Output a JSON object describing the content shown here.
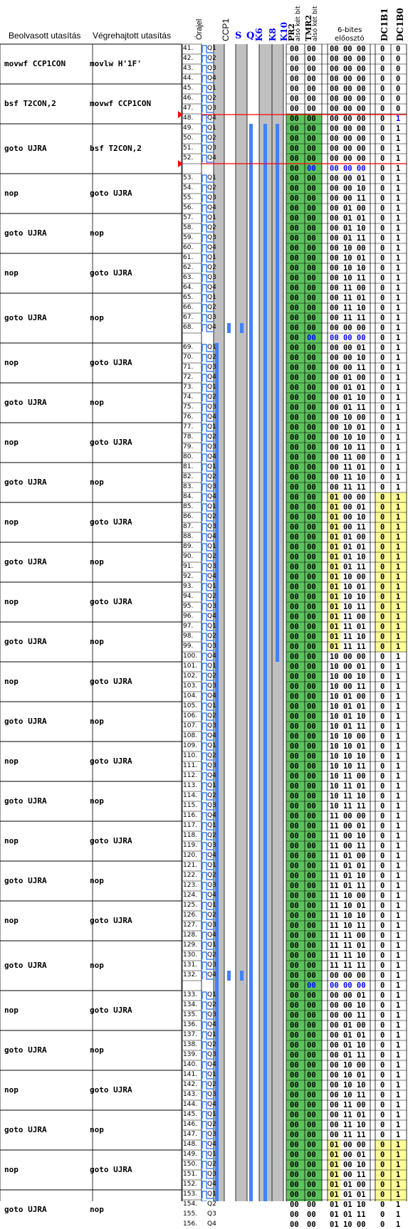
{
  "headers": {
    "read_instruction": "Beolvasott utasítás",
    "executed_instruction": "Végrehajtott utasítás",
    "clock": "Órajel",
    "ccp1": "CCP1",
    "s": "S",
    "q": "Q",
    "k6": "K6",
    "k8": "K8",
    "k10": "K10",
    "pr2_name": "PR2",
    "pr2_sub": "alsó két bit",
    "tmr2_name": "TMR2",
    "tmr2_sub": "alsó két bit",
    "prescaler_line1": "6-bites",
    "prescaler_line2": "előosztó",
    "dc1b1": "DC1B1",
    "dc1b0": "DC1B0"
  },
  "colors": {
    "grid": "#000000",
    "blue_wave": "#3f82ff",
    "blue_text": "#0000ff",
    "gray_column": "#c0c0c0",
    "green_fill": "#5dc35d",
    "yellow_fill": "#ffff99",
    "red_marker": "#ff0000"
  },
  "blocks": [
    {
      "read": "movwf  CCP1CON",
      "exec": "movlw  H'1F'"
    },
    {
      "read": "bsf    T2CON,2",
      "exec": "movwf  CCP1CON"
    },
    {
      "read": "goto   UJRA",
      "exec": "bsf    T2CON,2"
    },
    {
      "read": "nop",
      "exec": "goto   UJRA"
    },
    {
      "read": "goto   UJRA",
      "exec": "nop"
    },
    {
      "read": "nop",
      "exec": "goto   UJRA"
    },
    {
      "read": "goto   UJRA",
      "exec": "nop"
    },
    {
      "read": "nop",
      "exec": "goto   UJRA"
    },
    {
      "read": "goto   UJRA",
      "exec": "nop"
    },
    {
      "read": "nop",
      "exec": "goto   UJRA"
    },
    {
      "read": "goto   UJRA",
      "exec": "nop"
    },
    {
      "read": "nop",
      "exec": "goto   UJRA"
    },
    {
      "read": "goto   UJRA",
      "exec": "nop"
    },
    {
      "read": "nop",
      "exec": "goto   UJRA"
    },
    {
      "read": "goto   UJRA",
      "exec": "nop"
    },
    {
      "read": "nop",
      "exec": "goto   UJRA"
    },
    {
      "read": "goto   UJRA",
      "exec": "nop"
    },
    {
      "read": "nop",
      "exec": "goto   UJRA"
    },
    {
      "read": "goto   UJRA",
      "exec": "nop"
    },
    {
      "read": "nop",
      "exec": "goto   UJRA"
    },
    {
      "read": "goto   UJRA",
      "exec": "nop"
    },
    {
      "read": "nop",
      "exec": "goto   UJRA"
    },
    {
      "read": "goto   UJRA",
      "exec": "nop"
    },
    {
      "read": "nop",
      "exec": "goto   UJRA"
    },
    {
      "read": "goto   UJRA",
      "exec": "nop"
    },
    {
      "read": "nop",
      "exec": "goto   UJRA"
    },
    {
      "read": "goto   UJRA",
      "exec": "nop"
    },
    {
      "read": "nop",
      "exec": "goto   UJRA"
    },
    {
      "read": "goto   UJRA",
      "exec": "nop"
    }
  ],
  "rows": [
    {
      "n": "41.",
      "q": "Q1",
      "pr2": "00",
      "tmr2": "00",
      "pre": "00 00 00",
      "b1": "0",
      "b0": "0"
    },
    {
      "n": "42.",
      "q": "Q2",
      "pr2": "00",
      "tmr2": "00",
      "pre": "00 00 00",
      "b1": "0",
      "b0": "0"
    },
    {
      "n": "43.",
      "q": "Q3",
      "pr2": "00",
      "tmr2": "00",
      "pre": "00 00 00",
      "b1": "0",
      "b0": "0"
    },
    {
      "n": "44.",
      "q": "Q4",
      "pr2": "00",
      "tmr2": "00",
      "pre": "00 00 00",
      "b1": "0",
      "b0": "0"
    },
    {
      "n": "45.",
      "q": "Q1",
      "pr2": "00",
      "tmr2": "00",
      "pre": "00 00 00",
      "b1": "0",
      "b0": "0"
    },
    {
      "n": "46.",
      "q": "Q2",
      "pr2": "00",
      "tmr2": "00",
      "pre": "00 00 00",
      "b1": "0",
      "b0": "0"
    },
    {
      "n": "47.",
      "q": "Q3",
      "pr2": "00",
      "tmr2": "00",
      "pre": "00 00 00",
      "b1": "0",
      "b0": "0"
    },
    {
      "n": "48.",
      "q": "Q4",
      "pr2": "00",
      "tmr2": "00",
      "pre": "00 00 00",
      "b1": "0",
      "b0": "1"
    },
    {
      "n": "49.",
      "q": "Q1",
      "pr2": "00",
      "tmr2": "00",
      "pre": "00 00 00",
      "b1": "0",
      "b0": "1"
    },
    {
      "n": "50.",
      "q": "Q2",
      "pr2": "00",
      "tmr2": "00",
      "pre": "00 00 00",
      "b1": "0",
      "b0": "1"
    },
    {
      "n": "51.",
      "q": "Q3",
      "pr2": "00",
      "tmr2": "00",
      "pre": "00 00 00",
      "b1": "0",
      "b0": "1"
    },
    {
      "n": "52.",
      "q": "Q4",
      "pr2": "00",
      "tmr2": "00",
      "pre": "00 00 00",
      "b1": "0",
      "b0": "1"
    },
    {
      "n": "53.",
      "q": "Q1",
      "pr2": "00",
      "tmr2": "00",
      "pre": "00 00 01",
      "b1": "0",
      "b0": "1"
    },
    {
      "n": "54.",
      "q": "Q2",
      "pr2": "00",
      "tmr2": "00",
      "pre": "00 00 10",
      "b1": "0",
      "b0": "1"
    },
    {
      "n": "55.",
      "q": "Q3",
      "pr2": "00",
      "tmr2": "00",
      "pre": "00 00 11",
      "b1": "0",
      "b0": "1"
    },
    {
      "n": "56.",
      "q": "Q4",
      "pr2": "00",
      "tmr2": "00",
      "pre": "00 01 00",
      "b1": "0",
      "b0": "1"
    },
    {
      "n": "57.",
      "q": "Q1",
      "pr2": "00",
      "tmr2": "00",
      "pre": "00 01 01",
      "b1": "0",
      "b0": "1"
    },
    {
      "n": "58.",
      "q": "Q2",
      "pr2": "00",
      "tmr2": "00",
      "pre": "00 01 10",
      "b1": "0",
      "b0": "1"
    },
    {
      "n": "59.",
      "q": "Q3",
      "pr2": "00",
      "tmr2": "00",
      "pre": "00 01 11",
      "b1": "0",
      "b0": "1"
    },
    {
      "n": "60.",
      "q": "Q4",
      "pr2": "00",
      "tmr2": "00",
      "pre": "00 10 00",
      "b1": "0",
      "b0": "1"
    },
    {
      "n": "61.",
      "q": "Q1",
      "pr2": "00",
      "tmr2": "00",
      "pre": "00 10 01",
      "b1": "0",
      "b0": "1"
    },
    {
      "n": "62.",
      "q": "Q2",
      "pr2": "00",
      "tmr2": "00",
      "pre": "00 10 10",
      "b1": "0",
      "b0": "1"
    },
    {
      "n": "63.",
      "q": "Q3",
      "pr2": "00",
      "tmr2": "00",
      "pre": "00 10 11",
      "b1": "0",
      "b0": "1"
    },
    {
      "n": "64.",
      "q": "Q4",
      "pr2": "00",
      "tmr2": "00",
      "pre": "00 11 00",
      "b1": "0",
      "b0": "1"
    },
    {
      "n": "65.",
      "q": "Q1",
      "pr2": "00",
      "tmr2": "00",
      "pre": "00 11 01",
      "b1": "0",
      "b0": "1"
    },
    {
      "n": "66.",
      "q": "Q2",
      "pr2": "00",
      "tmr2": "00",
      "pre": "00 11 10",
      "b1": "0",
      "b0": "1"
    },
    {
      "n": "67.",
      "q": "Q3",
      "pr2": "00",
      "tmr2": "00",
      "pre": "00 11 11",
      "b1": "0",
      "b0": "1"
    },
    {
      "n": "68.",
      "q": "Q4",
      "pr2": "00",
      "tmr2": "00",
      "pre": "00 00 00",
      "b1": "0",
      "b0": "1"
    },
    {
      "n": "69.",
      "q": "Q1",
      "pr2": "00",
      "tmr2": "00",
      "pre": "00 00 01",
      "b1": "0",
      "b0": "1"
    },
    {
      "n": "70.",
      "q": "Q2",
      "pr2": "00",
      "tmr2": "00",
      "pre": "00 00 10",
      "b1": "0",
      "b0": "1"
    },
    {
      "n": "71.",
      "q": "Q3",
      "pr2": "00",
      "tmr2": "00",
      "pre": "00 00 11",
      "b1": "0",
      "b0": "1"
    },
    {
      "n": "72.",
      "q": "Q4",
      "pr2": "00",
      "tmr2": "00",
      "pre": "00 01 00",
      "b1": "0",
      "b0": "1"
    },
    {
      "n": "73.",
      "q": "Q1",
      "pr2": "00",
      "tmr2": "00",
      "pre": "00 01 01",
      "b1": "0",
      "b0": "1"
    },
    {
      "n": "74.",
      "q": "Q2",
      "pr2": "00",
      "tmr2": "00",
      "pre": "00 01 10",
      "b1": "0",
      "b0": "1"
    },
    {
      "n": "75.",
      "q": "Q3",
      "pr2": "00",
      "tmr2": "00",
      "pre": "00 01 11",
      "b1": "0",
      "b0": "1"
    },
    {
      "n": "76.",
      "q": "Q4",
      "pr2": "00",
      "tmr2": "00",
      "pre": "00 10 00",
      "b1": "0",
      "b0": "1"
    },
    {
      "n": "77.",
      "q": "Q1",
      "pr2": "00",
      "tmr2": "00",
      "pre": "00 10 01",
      "b1": "0",
      "b0": "1"
    },
    {
      "n": "78.",
      "q": "Q2",
      "pr2": "00",
      "tmr2": "00",
      "pre": "00 10 10",
      "b1": "0",
      "b0": "1"
    },
    {
      "n": "79.",
      "q": "Q3",
      "pr2": "00",
      "tmr2": "00",
      "pre": "00 10 11",
      "b1": "0",
      "b0": "1"
    },
    {
      "n": "80.",
      "q": "Q4",
      "pr2": "00",
      "tmr2": "00",
      "pre": "00 11 00",
      "b1": "0",
      "b0": "1"
    },
    {
      "n": "81.",
      "q": "Q1",
      "pr2": "00",
      "tmr2": "00",
      "pre": "00 11 01",
      "b1": "0",
      "b0": "1"
    },
    {
      "n": "82.",
      "q": "Q2",
      "pr2": "00",
      "tmr2": "00",
      "pre": "00 11 10",
      "b1": "0",
      "b0": "1"
    },
    {
      "n": "83.",
      "q": "Q3",
      "pr2": "00",
      "tmr2": "00",
      "pre": "00 11 11",
      "b1": "0",
      "b0": "1"
    },
    {
      "n": "84.",
      "q": "Q4",
      "pr2": "00",
      "tmr2": "00",
      "pre": "01 00 00",
      "b1": "0",
      "b0": "1"
    },
    {
      "n": "85.",
      "q": "Q1",
      "pr2": "00",
      "tmr2": "00",
      "pre": "01 00 01",
      "b1": "0",
      "b0": "1"
    },
    {
      "n": "86.",
      "q": "Q2",
      "pr2": "00",
      "tmr2": "00",
      "pre": "01 00 10",
      "b1": "0",
      "b0": "1"
    },
    {
      "n": "87.",
      "q": "Q3",
      "pr2": "00",
      "tmr2": "00",
      "pre": "01 00 11",
      "b1": "0",
      "b0": "1"
    },
    {
      "n": "88.",
      "q": "Q4",
      "pr2": "00",
      "tmr2": "00",
      "pre": "01 01 00",
      "b1": "0",
      "b0": "1"
    },
    {
      "n": "89.",
      "q": "Q1",
      "pr2": "00",
      "tmr2": "00",
      "pre": "01 01 01",
      "b1": "0",
      "b0": "1"
    },
    {
      "n": "90.",
      "q": "Q2",
      "pr2": "00",
      "tmr2": "00",
      "pre": "01 01 10",
      "b1": "0",
      "b0": "1"
    },
    {
      "n": "91.",
      "q": "Q3",
      "pr2": "00",
      "tmr2": "00",
      "pre": "01 01 11",
      "b1": "0",
      "b0": "1"
    },
    {
      "n": "92.",
      "q": "Q4",
      "pr2": "00",
      "tmr2": "00",
      "pre": "01 10 00",
      "b1": "0",
      "b0": "1"
    },
    {
      "n": "93.",
      "q": "Q1",
      "pr2": "00",
      "tmr2": "00",
      "pre": "01 10 01",
      "b1": "0",
      "b0": "1"
    },
    {
      "n": "94.",
      "q": "Q2",
      "pr2": "00",
      "tmr2": "00",
      "pre": "01 10 10",
      "b1": "0",
      "b0": "1"
    },
    {
      "n": "95.",
      "q": "Q3",
      "pr2": "00",
      "tmr2": "00",
      "pre": "01 10 11",
      "b1": "0",
      "b0": "1"
    },
    {
      "n": "96.",
      "q": "Q4",
      "pr2": "00",
      "tmr2": "00",
      "pre": "01 11 00",
      "b1": "0",
      "b0": "1"
    },
    {
      "n": "97.",
      "q": "Q1",
      "pr2": "00",
      "tmr2": "00",
      "pre": "01 11 01",
      "b1": "0",
      "b0": "1"
    },
    {
      "n": "98.",
      "q": "Q2",
      "pr2": "00",
      "tmr2": "00",
      "pre": "01 11 10",
      "b1": "0",
      "b0": "1"
    },
    {
      "n": "99.",
      "q": "Q3",
      "pr2": "00",
      "tmr2": "00",
      "pre": "01 11 11",
      "b1": "0",
      "b0": "1"
    },
    {
      "n": "100.",
      "q": "Q4",
      "pr2": "00",
      "tmr2": "00",
      "pre": "10 00 00",
      "b1": "0",
      "b0": "1"
    },
    {
      "n": "101.",
      "q": "Q1",
      "pr2": "00",
      "tmr2": "00",
      "pre": "10 00 01",
      "b1": "0",
      "b0": "1"
    },
    {
      "n": "102.",
      "q": "Q2",
      "pr2": "00",
      "tmr2": "00",
      "pre": "10 00 10",
      "b1": "0",
      "b0": "1"
    },
    {
      "n": "103.",
      "q": "Q3",
      "pr2": "00",
      "tmr2": "00",
      "pre": "10 00 11",
      "b1": "0",
      "b0": "1"
    },
    {
      "n": "104.",
      "q": "Q4",
      "pr2": "00",
      "tmr2": "00",
      "pre": "10 01 00",
      "b1": "0",
      "b0": "1"
    },
    {
      "n": "105.",
      "q": "Q1",
      "pr2": "00",
      "tmr2": "00",
      "pre": "10 01 01",
      "b1": "0",
      "b0": "1"
    },
    {
      "n": "106.",
      "q": "Q2",
      "pr2": "00",
      "tmr2": "00",
      "pre": "10 01 10",
      "b1": "0",
      "b0": "1"
    },
    {
      "n": "107.",
      "q": "Q3",
      "pr2": "00",
      "tmr2": "00",
      "pre": "10 01 11",
      "b1": "0",
      "b0": "1"
    },
    {
      "n": "108.",
      "q": "Q4",
      "pr2": "00",
      "tmr2": "00",
      "pre": "10 10 00",
      "b1": "0",
      "b0": "1"
    },
    {
      "n": "109.",
      "q": "Q1",
      "pr2": "00",
      "tmr2": "00",
      "pre": "10 10 01",
      "b1": "0",
      "b0": "1"
    },
    {
      "n": "110.",
      "q": "Q2",
      "pr2": "00",
      "tmr2": "00",
      "pre": "10 10 10",
      "b1": "0",
      "b0": "1"
    },
    {
      "n": "111.",
      "q": "Q3",
      "pr2": "00",
      "tmr2": "00",
      "pre": "10 10 11",
      "b1": "0",
      "b0": "1"
    },
    {
      "n": "112.",
      "q": "Q4",
      "pr2": "00",
      "tmr2": "00",
      "pre": "10 11 00",
      "b1": "0",
      "b0": "1"
    },
    {
      "n": "113.",
      "q": "Q1",
      "pr2": "00",
      "tmr2": "00",
      "pre": "10 11 01",
      "b1": "0",
      "b0": "1"
    },
    {
      "n": "114.",
      "q": "Q2",
      "pr2": "00",
      "tmr2": "00",
      "pre": "10 11 10",
      "b1": "0",
      "b0": "1"
    },
    {
      "n": "115.",
      "q": "Q3",
      "pr2": "00",
      "tmr2": "00",
      "pre": "10 11 11",
      "b1": "0",
      "b0": "1"
    },
    {
      "n": "116.",
      "q": "Q4",
      "pr2": "00",
      "tmr2": "00",
      "pre": "11 00 00",
      "b1": "0",
      "b0": "1"
    },
    {
      "n": "117.",
      "q": "Q1",
      "pr2": "00",
      "tmr2": "00",
      "pre": "11 00 01",
      "b1": "0",
      "b0": "1"
    },
    {
      "n": "118.",
      "q": "Q2",
      "pr2": "00",
      "tmr2": "00",
      "pre": "11 00 10",
      "b1": "0",
      "b0": "1"
    },
    {
      "n": "119.",
      "q": "Q3",
      "pr2": "00",
      "tmr2": "00",
      "pre": "11 00 11",
      "b1": "0",
      "b0": "1"
    },
    {
      "n": "120.",
      "q": "Q4",
      "pr2": "00",
      "tmr2": "00",
      "pre": "11 01 00",
      "b1": "0",
      "b0": "1"
    },
    {
      "n": "121.",
      "q": "Q1",
      "pr2": "00",
      "tmr2": "00",
      "pre": "11 01 01",
      "b1": "0",
      "b0": "1"
    },
    {
      "n": "122.",
      "q": "Q2",
      "pr2": "00",
      "tmr2": "00",
      "pre": "11 01 10",
      "b1": "0",
      "b0": "1"
    },
    {
      "n": "123.",
      "q": "Q3",
      "pr2": "00",
      "tmr2": "00",
      "pre": "11 01 11",
      "b1": "0",
      "b0": "1"
    },
    {
      "n": "124.",
      "q": "Q4",
      "pr2": "00",
      "tmr2": "00",
      "pre": "11 10 00",
      "b1": "0",
      "b0": "1"
    },
    {
      "n": "125.",
      "q": "Q1",
      "pr2": "00",
      "tmr2": "00",
      "pre": "11 10 01",
      "b1": "0",
      "b0": "1"
    },
    {
      "n": "126.",
      "q": "Q2",
      "pr2": "00",
      "tmr2": "00",
      "pre": "11 10 10",
      "b1": "0",
      "b0": "1"
    },
    {
      "n": "127.",
      "q": "Q3",
      "pr2": "00",
      "tmr2": "00",
      "pre": "11 10 11",
      "b1": "0",
      "b0": "1"
    },
    {
      "n": "128.",
      "q": "Q4",
      "pr2": "00",
      "tmr2": "00",
      "pre": "11 11 00",
      "b1": "0",
      "b0": "1"
    },
    {
      "n": "129.",
      "q": "Q1",
      "pr2": "00",
      "tmr2": "00",
      "pre": "11 11 01",
      "b1": "0",
      "b0": "1"
    },
    {
      "n": "130.",
      "q": "Q2",
      "pr2": "00",
      "tmr2": "00",
      "pre": "11 11 10",
      "b1": "0",
      "b0": "1"
    },
    {
      "n": "131.",
      "q": "Q3",
      "pr2": "00",
      "tmr2": "00",
      "pre": "11 11 11",
      "b1": "0",
      "b0": "1"
    },
    {
      "n": "132.",
      "q": "Q4",
      "pr2": "00",
      "tmr2": "00",
      "pre": "00 00 00",
      "b1": "0",
      "b0": "1"
    },
    {
      "n": "133.",
      "q": "Q1",
      "pr2": "00",
      "tmr2": "00",
      "pre": "00 00 01",
      "b1": "0",
      "b0": "1"
    },
    {
      "n": "134.",
      "q": "Q2",
      "pr2": "00",
      "tmr2": "00",
      "pre": "00 00 10",
      "b1": "0",
      "b0": "1"
    },
    {
      "n": "135.",
      "q": "Q3",
      "pr2": "00",
      "tmr2": "00",
      "pre": "00 00 11",
      "b1": "0",
      "b0": "1"
    },
    {
      "n": "136.",
      "q": "Q4",
      "pr2": "00",
      "tmr2": "00",
      "pre": "00 01 00",
      "b1": "0",
      "b0": "1"
    },
    {
      "n": "137.",
      "q": "Q1",
      "pr2": "00",
      "tmr2": "00",
      "pre": "00 01 01",
      "b1": "0",
      "b0": "1"
    },
    {
      "n": "138.",
      "q": "Q2",
      "pr2": "00",
      "tmr2": "00",
      "pre": "00 01 10",
      "b1": "0",
      "b0": "1"
    },
    {
      "n": "139.",
      "q": "Q3",
      "pr2": "00",
      "tmr2": "00",
      "pre": "00 01 11",
      "b1": "0",
      "b0": "1"
    },
    {
      "n": "140.",
      "q": "Q4",
      "pr2": "00",
      "tmr2": "00",
      "pre": "00 10 00",
      "b1": "0",
      "b0": "1"
    },
    {
      "n": "141.",
      "q": "Q1",
      "pr2": "00",
      "tmr2": "00",
      "pre": "00 10 01",
      "b1": "0",
      "b0": "1"
    },
    {
      "n": "142.",
      "q": "Q2",
      "pr2": "00",
      "tmr2": "00",
      "pre": "00 10 10",
      "b1": "0",
      "b0": "1"
    },
    {
      "n": "143.",
      "q": "Q3",
      "pr2": "00",
      "tmr2": "00",
      "pre": "00 10 11",
      "b1": "0",
      "b0": "1"
    },
    {
      "n": "144.",
      "q": "Q4",
      "pr2": "00",
      "tmr2": "00",
      "pre": "00 11 00",
      "b1": "0",
      "b0": "1"
    },
    {
      "n": "145.",
      "q": "Q1",
      "pr2": "00",
      "tmr2": "00",
      "pre": "00 11 01",
      "b1": "0",
      "b0": "1"
    },
    {
      "n": "146.",
      "q": "Q2",
      "pr2": "00",
      "tmr2": "00",
      "pre": "00 11 10",
      "b1": "0",
      "b0": "1"
    },
    {
      "n": "147.",
      "q": "Q3",
      "pr2": "00",
      "tmr2": "00",
      "pre": "00 11 11",
      "b1": "0",
      "b0": "1"
    },
    {
      "n": "148.",
      "q": "Q4",
      "pr2": "00",
      "tmr2": "00",
      "pre": "01 00 00",
      "b1": "0",
      "b0": "1"
    },
    {
      "n": "149.",
      "q": "Q1",
      "pr2": "00",
      "tmr2": "00",
      "pre": "01 00 01",
      "b1": "0",
      "b0": "1"
    },
    {
      "n": "150.",
      "q": "Q2",
      "pr2": "00",
      "tmr2": "00",
      "pre": "01 00 10",
      "b1": "0",
      "b0": "1"
    },
    {
      "n": "151.",
      "q": "Q3",
      "pr2": "00",
      "tmr2": "00",
      "pre": "01 00 11",
      "b1": "0",
      "b0": "1"
    },
    {
      "n": "152.",
      "q": "Q4",
      "pr2": "00",
      "tmr2": "00",
      "pre": "01 01 00",
      "b1": "0",
      "b0": "1"
    },
    {
      "n": "153.",
      "q": "Q1",
      "pr2": "00",
      "tmr2": "00",
      "pre": "01 01 01",
      "b1": "0",
      "b0": "1"
    },
    {
      "n": "154.",
      "q": "Q2",
      "pr2": "00",
      "tmr2": "00",
      "pre": "01 01 10",
      "b1": "0",
      "b0": "1"
    },
    {
      "n": "155.",
      "q": "Q3",
      "pr2": "00",
      "tmr2": "00",
      "pre": "01 01 11",
      "b1": "0",
      "b0": "1"
    },
    {
      "n": "156.",
      "q": "Q4",
      "pr2": "00",
      "tmr2": "00",
      "pre": "01 10 00",
      "b1": "0",
      "b0": "1"
    }
  ],
  "extra_rows_after": [
    {
      "after": "52.",
      "pr2": "00",
      "tmr2": "00",
      "pre": "00 00 00",
      "b1": "0",
      "b0": "1"
    },
    {
      "after": "68.",
      "pr2": "00",
      "tmr2": "00",
      "pre": "00 00 00",
      "b1": "0",
      "b0": "1"
    },
    {
      "after": "132.",
      "pr2": "00",
      "tmr2": "00",
      "pre": "00 00 00",
      "b1": "0",
      "b0": "1"
    }
  ]
}
